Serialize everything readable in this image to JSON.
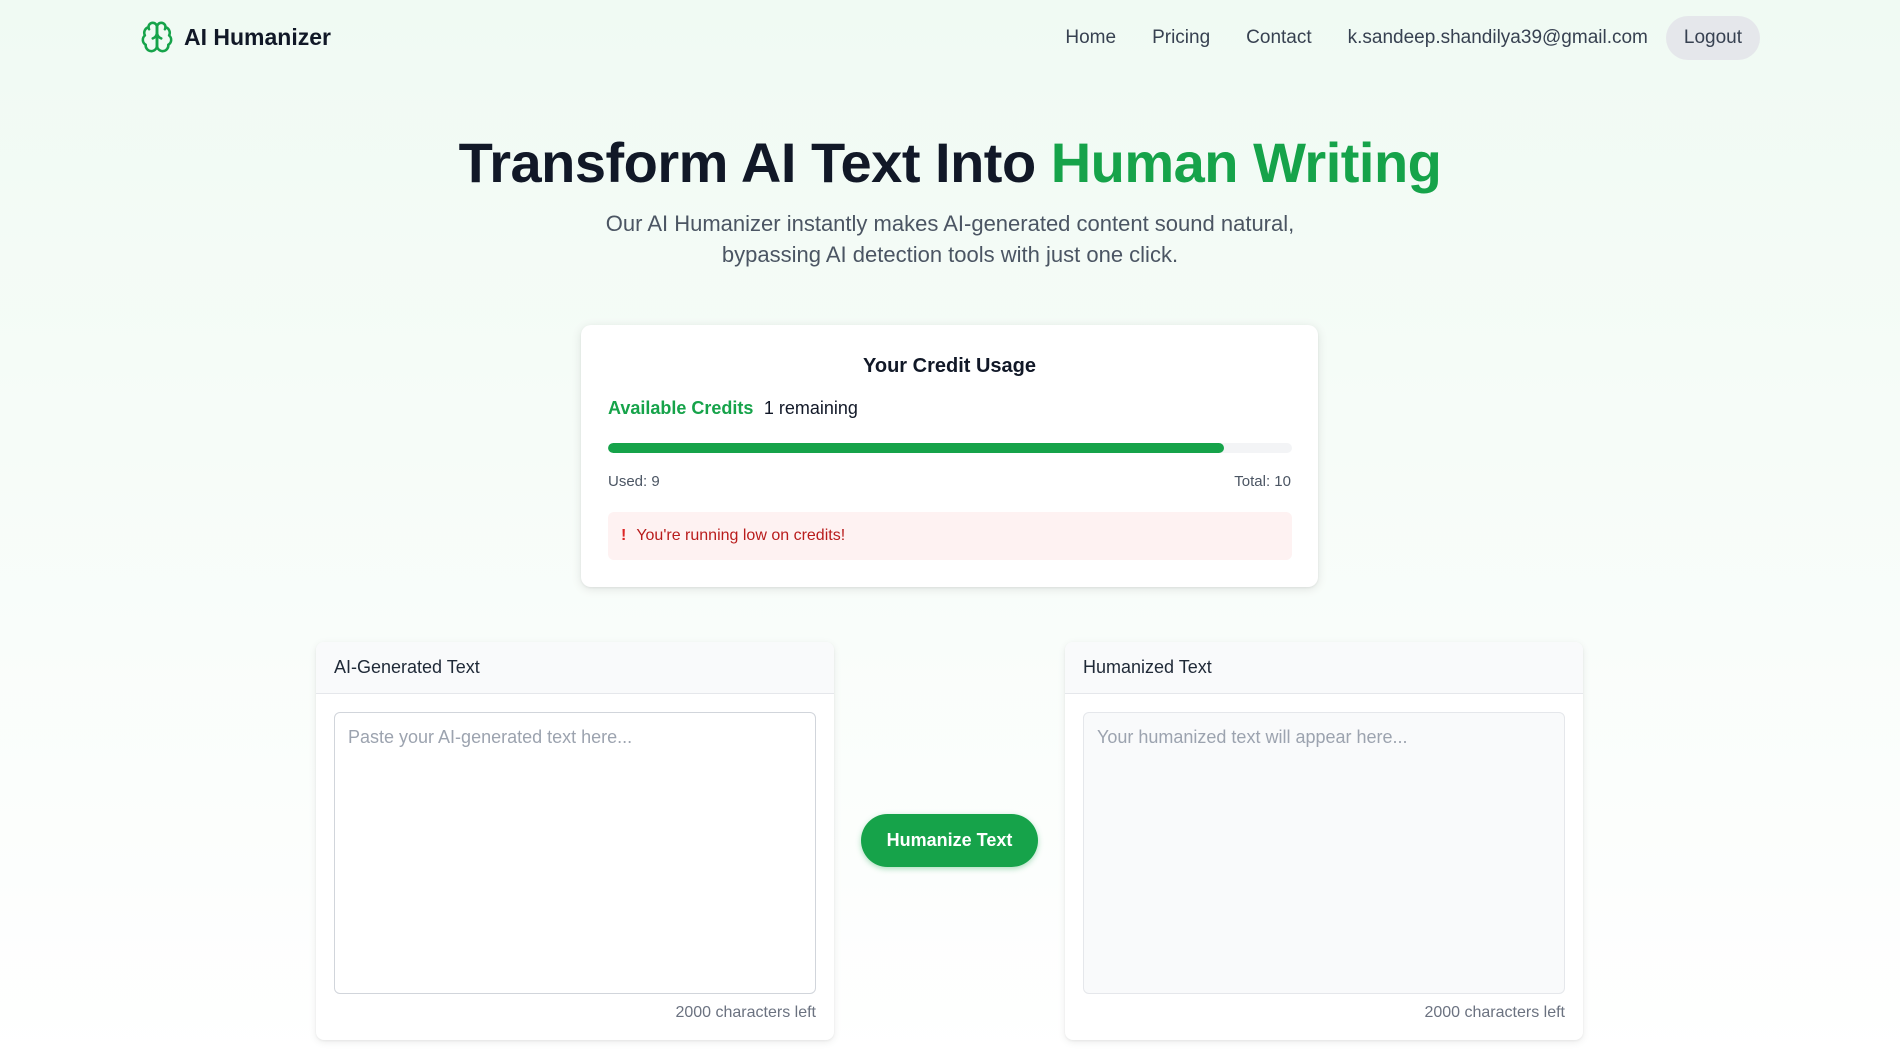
{
  "brand": {
    "name": "AI Humanizer",
    "icon": "brain-icon",
    "color": "#16a34a"
  },
  "nav": {
    "links": [
      "Home",
      "Pricing",
      "Contact"
    ],
    "user_email": "k.sandeep.shandilya39@gmail.com",
    "logout_label": "Logout"
  },
  "hero": {
    "title_main": "Transform AI Text Into ",
    "title_accent": "Human Writing",
    "subtitle_line1": "Our AI Humanizer instantly makes AI-generated content sound natural,",
    "subtitle_line2": "bypassing AI detection tools with just one click."
  },
  "credits": {
    "title": "Your Credit Usage",
    "available_label": "Available Credits",
    "remaining_text": "1 remaining",
    "used_text": "Used: 9",
    "total_text": "Total: 10",
    "used_fraction": 0.9,
    "warning_icon": "!",
    "warning_text": "You're running low on credits!"
  },
  "input_panel": {
    "title": "AI-Generated Text",
    "placeholder": "Paste your AI-generated text here...",
    "value": "",
    "chars_left": "2000 characters left"
  },
  "output_panel": {
    "title": "Humanized Text",
    "placeholder": "Your humanized text will appear here...",
    "value": "",
    "chars_left": "2000 characters left"
  },
  "action": {
    "humanize_label": "Humanize Text"
  },
  "colors": {
    "accent": "#16a34a",
    "warning_bg": "#fef2f2",
    "warning_text": "#b91c1c"
  }
}
